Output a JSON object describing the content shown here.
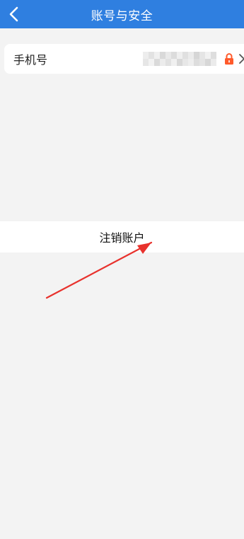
{
  "header": {
    "title": "账号与安全",
    "back_icon": "chevron-left-icon",
    "background": "#2f7fe0"
  },
  "phone_row": {
    "label": "手机号",
    "value_masked": true,
    "lock_icon": "lock-icon",
    "lock_color": "#ff5a2b",
    "chevron_icon": "chevron-right-icon"
  },
  "cancel_account": {
    "label": "注销账户"
  },
  "annotation": {
    "icon": "red-arrow-annotation",
    "color": "#e8322d"
  }
}
